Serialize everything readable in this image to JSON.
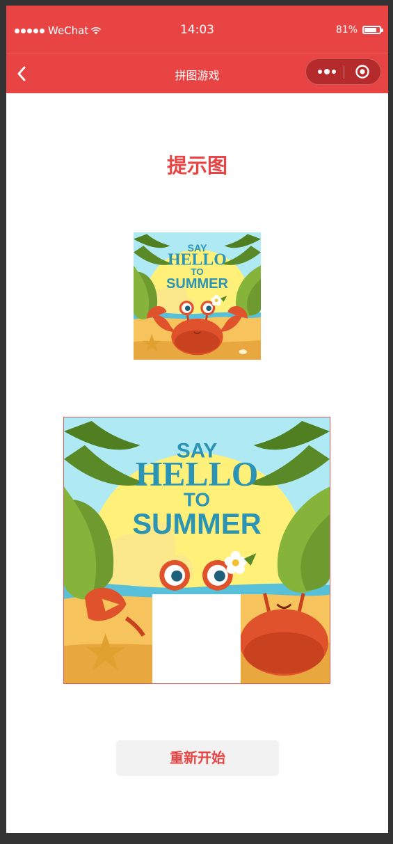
{
  "status_bar": {
    "carrier": "WeChat",
    "time": "14:03",
    "battery": "81%",
    "battery_level": 0.81,
    "signal_icon": "signal-dots-icon",
    "wifi_icon": "wifi-icon",
    "battery_icon": "battery-icon"
  },
  "nav": {
    "title": "拼图游戏",
    "back_icon": "chevron-left-icon",
    "more_icon": "more-dots-icon",
    "close_icon": "target-circle-icon"
  },
  "hint": {
    "title": "提示图",
    "image_text": {
      "line1": "SAY",
      "line2": "HELLO",
      "line3": "TO",
      "line4": "SUMMER"
    }
  },
  "puzzle": {
    "grid": 3,
    "empty_tile": {
      "row": 3,
      "col": 2
    },
    "image_text": {
      "line1": "SAY",
      "line2": "HELLO",
      "line3": "TO",
      "line4": "SUMMER"
    }
  },
  "restart_button": {
    "label": "重新开始"
  },
  "colors": {
    "accent": "#e84444",
    "button_bg": "#f2f2f2",
    "sky": "#aee9f4",
    "sun": "#fff07a",
    "sand": "#f7c35c",
    "crab": "#e0522c",
    "leaf": "#5a8a28",
    "text_blue": "#2b94b5"
  }
}
